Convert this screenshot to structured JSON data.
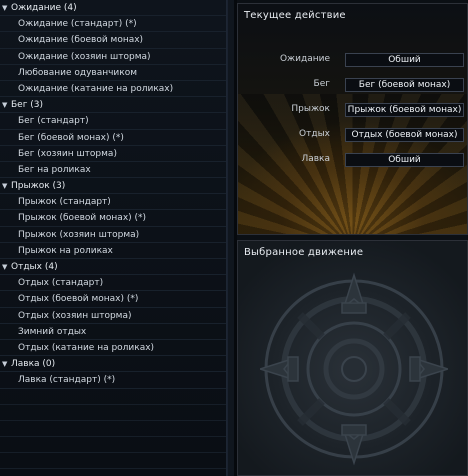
{
  "tree": [
    {
      "label": "Ожидание (4)",
      "items": [
        "Ожидание (стандарт) (*)",
        "Ожидание (боевой монах)",
        "Ожидание (хозяин шторма)",
        "Любование одуванчиком",
        "Ожидание (катание на роликах)"
      ]
    },
    {
      "label": "Бег (3)",
      "items": [
        "Бег (стандарт)",
        "Бег (боевой монах) (*)",
        "Бег (хозяин шторма)",
        "Бег на роликах"
      ]
    },
    {
      "label": "Прыжок (3)",
      "items": [
        "Прыжок (стандарт)",
        "Прыжок (боевой монах) (*)",
        "Прыжок (хозяин шторма)",
        "Прыжок на роликах"
      ]
    },
    {
      "label": "Отдых (4)",
      "items": [
        "Отдых (стандарт)",
        "Отдых (боевой монах) (*)",
        "Отдых (хозяин шторма)",
        "Зимний отдых",
        "Отдых (катание на роликах)"
      ]
    },
    {
      "label": "Лавка (0)",
      "items": [
        "Лавка (стандарт) (*)"
      ]
    }
  ],
  "current_action": {
    "title": "Текущее действие",
    "rows": [
      {
        "label": "Ожидание",
        "value": "Обший"
      },
      {
        "label": "Бег",
        "value": "Бег (боевой монах)"
      },
      {
        "label": "Прыжок",
        "value": "Прыжок (боевой монах)"
      },
      {
        "label": "Отдых",
        "value": "Отдых (боевой монах)"
      },
      {
        "label": "Лавка",
        "value": "Обший"
      }
    ]
  },
  "selected_motion": {
    "title": "Выбранное движение"
  },
  "icons": {
    "expanded": "triangle-down-icon",
    "emblem": "compass-emblem-icon"
  },
  "colors": {
    "background": "#0b0f14",
    "accent_gold": "#6b4a14"
  }
}
